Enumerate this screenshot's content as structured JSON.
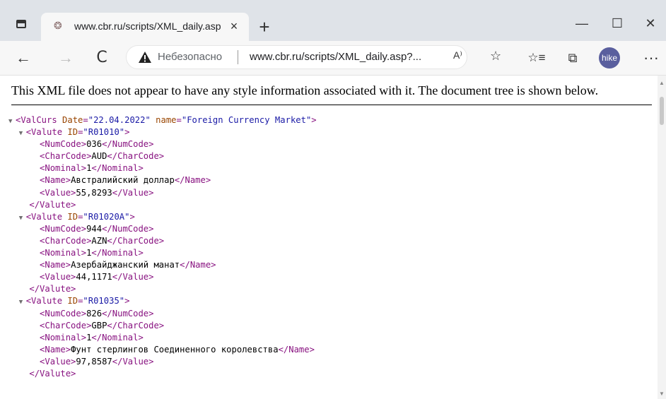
{
  "tab": {
    "title": "www.cbr.ru/scripts/XML_daily.asp",
    "close": "×"
  },
  "new_tab": "+",
  "window": {
    "minimize": "—",
    "maximize": "☐",
    "close": "✕"
  },
  "toolbar": {
    "back": "←",
    "forward": "→",
    "refresh": "C",
    "not_secure": "Небезопасно",
    "url": "www.cbr.ru/scripts/XML_daily.asp?...",
    "read_aloud": "A⁾",
    "favorites_add": "☆",
    "favorites": "☆≡",
    "collections": "⧉",
    "profile": "hike",
    "more": "···"
  },
  "info_message": "This XML file does not appear to have any style information associated with it. The document tree is shown below.",
  "xml": {
    "root": {
      "tag": "ValCurs",
      "date_attr": "Date",
      "date": "22.04.2022",
      "name_attr": "name",
      "name": "Foreign Currency Market"
    },
    "valutes": [
      {
        "id": "R01010",
        "numcode": "036",
        "charcode": "AUD",
        "nominal": "1",
        "name": "Австралийский доллар",
        "value": "55,8293"
      },
      {
        "id": "R01020A",
        "numcode": "944",
        "charcode": "AZN",
        "nominal": "1",
        "name": "Азербайджанский манат",
        "value": "44,1171"
      },
      {
        "id": "R01035",
        "numcode": "826",
        "charcode": "GBP",
        "nominal": "1",
        "name": "Фунт стерлингов Соединенного королевства",
        "value": "97,8587"
      }
    ]
  },
  "colors": {
    "tag": "#881280",
    "attr": "#994500",
    "value": "#1a1aa6"
  }
}
